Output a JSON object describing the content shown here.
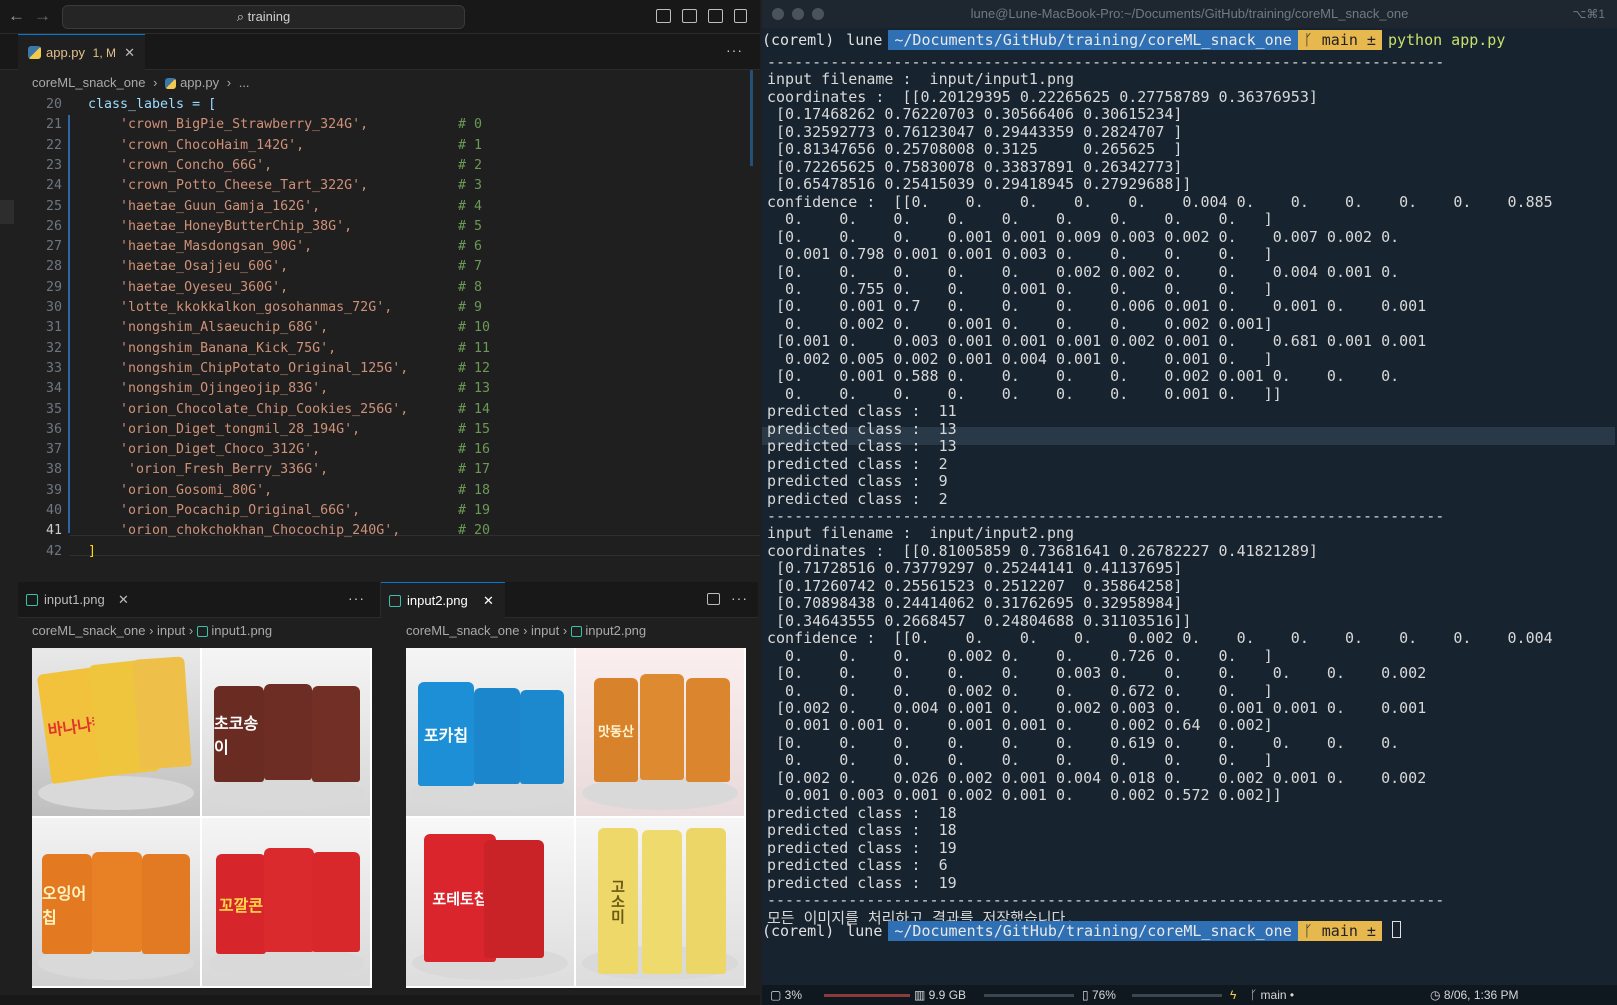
{
  "window": {
    "search_text": "training"
  },
  "editor": {
    "tab_label": "app.py",
    "tab_badge": "1, M",
    "breadcrumb": [
      "coreML_snack_one",
      "app.py",
      "..."
    ],
    "lines": [
      {
        "n": "20",
        "code": "class_labels = [",
        "comment": ""
      },
      {
        "n": "21",
        "code": "    'crown_BigPie_Strawberry_324G',",
        "comment": "# 0"
      },
      {
        "n": "22",
        "code": "    'crown_ChocoHaim_142G',",
        "comment": "# 1"
      },
      {
        "n": "23",
        "code": "    'crown_Concho_66G',",
        "comment": "# 2"
      },
      {
        "n": "24",
        "code": "    'crown_Potto_Cheese_Tart_322G',",
        "comment": "# 3"
      },
      {
        "n": "25",
        "code": "    'haetae_Guun_Gamja_162G',",
        "comment": "# 4"
      },
      {
        "n": "26",
        "code": "    'haetae_HoneyButterChip_38G',",
        "comment": "# 5"
      },
      {
        "n": "27",
        "code": "    'haetae_Masdongsan_90G',",
        "comment": "# 6"
      },
      {
        "n": "28",
        "code": "    'haetae_Osajjeu_60G',",
        "comment": "# 7"
      },
      {
        "n": "29",
        "code": "    'haetae_Oyeseu_360G',",
        "comment": "# 8"
      },
      {
        "n": "30",
        "code": "    'lotte_kkokkalkon_gosohanmas_72G',",
        "comment": "# 9"
      },
      {
        "n": "31",
        "code": "    'nongshim_Alsaeuchip_68G',",
        "comment": "# 10"
      },
      {
        "n": "32",
        "code": "    'nongshim_Banana_Kick_75G',",
        "comment": "# 11"
      },
      {
        "n": "33",
        "code": "    'nongshim_ChipPotato_Original_125G',",
        "comment": "# 12"
      },
      {
        "n": "34",
        "code": "    'nongshim_Ojingeojip_83G',",
        "comment": "# 13"
      },
      {
        "n": "35",
        "code": "    'orion_Chocolate_Chip_Cookies_256G',",
        "comment": "# 14"
      },
      {
        "n": "36",
        "code": "    'orion_Diget_tongmil_28_194G',",
        "comment": "# 15"
      },
      {
        "n": "37",
        "code": "    'orion_Diget_Choco_312G',",
        "comment": "# 16"
      },
      {
        "n": "38",
        "code": "     'orion_Fresh_Berry_336G',",
        "comment": "# 17"
      },
      {
        "n": "39",
        "code": "    'orion_Gosomi_80G',",
        "comment": "# 18"
      },
      {
        "n": "40",
        "code": "    'orion_Pocachip_Original_66G',",
        "comment": "# 19"
      },
      {
        "n": "41",
        "code": "    'orion_chokchokhan_Chocochip_240G',",
        "comment": "# 20"
      },
      {
        "n": "42",
        "code": "]",
        "comment": ""
      }
    ]
  },
  "panes": [
    {
      "tab": "input1.png",
      "crumb": [
        "coreML_snack_one",
        "input",
        "input1.png"
      ],
      "products": [
        "바나나킥",
        "초코송이",
        "오잉어칩",
        "꼬깔콘"
      ]
    },
    {
      "tab": "input2.png",
      "crumb": [
        "coreML_snack_one",
        "input",
        "input2.png"
      ],
      "products": [
        "포카칩",
        "맛동산",
        "포테토칩",
        "고소미"
      ]
    }
  ],
  "terminal": {
    "title": "lune@Lune-MacBook-Pro:~/Documents/GitHub/training/coreML_snack_one",
    "shortcut": "⌥⌘1",
    "prompt": {
      "env": "(coreml)",
      "user": "lune",
      "path": "~/Documents/GitHub/training/coreML_snack_one",
      "branch": "main ±",
      "command": "python app.py"
    },
    "lines": [
      "---------------------------------------------------------------------------",
      "input filename :  input/input1.png",
      "coordinates :  [[0.20129395 0.22265625 0.27758789 0.36376953]",
      " [0.17468262 0.76220703 0.30566406 0.30615234]",
      " [0.32592773 0.76123047 0.29443359 0.2824707 ]",
      " [0.81347656 0.25708008 0.3125     0.265625  ]",
      " [0.72265625 0.75830078 0.33837891 0.26342773]",
      " [0.65478516 0.25415039 0.29418945 0.27929688]]",
      "confidence :  [[0.    0.    0.    0.    0.    0.004 0.    0.    0.    0.    0.    0.885",
      "  0.    0.    0.    0.    0.    0.    0.    0.    0.   ]",
      " [0.    0.    0.    0.001 0.001 0.009 0.003 0.002 0.    0.007 0.002 0.",
      "  0.001 0.798 0.001 0.001 0.003 0.    0.    0.    0.   ]",
      " [0.    0.    0.    0.    0.    0.002 0.002 0.    0.    0.004 0.001 0.",
      "  0.    0.755 0.    0.    0.001 0.    0.    0.    0.   ]",
      " [0.    0.001 0.7   0.    0.    0.    0.006 0.001 0.    0.001 0.    0.001",
      "  0.    0.002 0.    0.001 0.    0.    0.    0.002 0.001]",
      " [0.001 0.    0.003 0.001 0.001 0.001 0.002 0.001 0.    0.681 0.001 0.001",
      "  0.002 0.005 0.002 0.001 0.004 0.001 0.    0.001 0.   ]",
      " [0.    0.001 0.588 0.    0.    0.    0.    0.002 0.001 0.    0.    0.",
      "  0.    0.    0.    0.    0.    0.    0.    0.001 0.   ]]",
      "predicted class :  11",
      "predicted class :  13",
      "predicted class :  13",
      "predicted class :  2",
      "predicted class :  9",
      "predicted class :  2",
      "---------------------------------------------------------------------------",
      "input filename :  input/input2.png",
      "coordinates :  [[0.81005859 0.73681641 0.26782227 0.41821289]",
      " [0.71728516 0.73779297 0.25244141 0.41137695]",
      " [0.17260742 0.25561523 0.2512207  0.35864258]",
      " [0.70898438 0.24414062 0.31762695 0.32958984]",
      " [0.34643555 0.2668457  0.24804688 0.31103516]]",
      "confidence :  [[0.    0.    0.    0.    0.002 0.    0.    0.    0.    0.    0.    0.004",
      "  0.    0.    0.    0.002 0.    0.    0.726 0.    0.   ]",
      " [0.    0.    0.    0.    0.    0.003 0.    0.    0.    0.    0.    0.002",
      "  0.    0.    0.    0.002 0.    0.    0.672 0.    0.   ]",
      " [0.002 0.    0.004 0.001 0.    0.002 0.003 0.    0.001 0.001 0.    0.001",
      "  0.001 0.001 0.    0.001 0.001 0.    0.002 0.64  0.002]",
      " [0.    0.    0.    0.    0.    0.    0.619 0.    0.    0.    0.    0.",
      "  0.    0.    0.    0.    0.    0.    0.    0.    0.   ]",
      " [0.002 0.    0.026 0.002 0.001 0.004 0.018 0.    0.002 0.001 0.    0.002",
      "  0.001 0.003 0.001 0.002 0.001 0.    0.002 0.572 0.002]]",
      "predicted class :  18",
      "predicted class :  18",
      "predicted class :  19",
      "predicted class :  6",
      "predicted class :  19",
      "---------------------------------------------------------------------------",
      "모든 이미지를 처리하고 결과를 저장했습니다."
    ],
    "status": {
      "cpu": "3%",
      "mem": "9.9 GB",
      "battery": "76%",
      "branch": "main",
      "time": "8/06, 1:36 PM"
    }
  }
}
